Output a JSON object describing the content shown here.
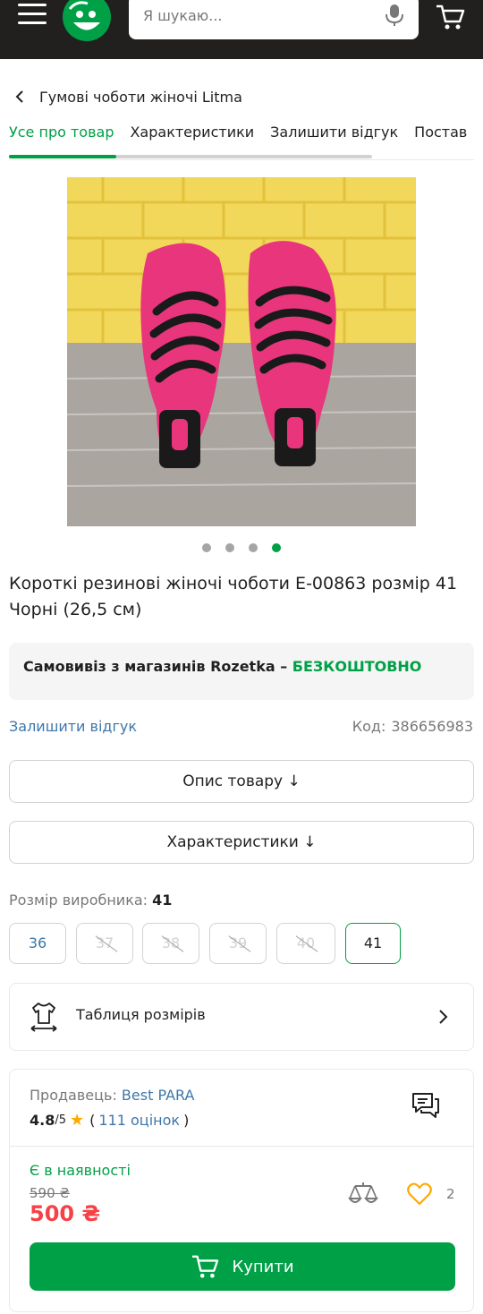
{
  "header": {
    "search_placeholder": "Я шукаю...",
    "colors": {
      "bg": "#221f1f",
      "logo": "#00a046"
    },
    "icons": [
      "menu-icon",
      "rozetka-logo",
      "microphone-icon",
      "cart-icon"
    ]
  },
  "breadcrumb": {
    "title": "Гумові чоботи жіночі Litma"
  },
  "tabs": [
    {
      "label": "Усе про товар",
      "active": true
    },
    {
      "label": "Характеристики",
      "active": false
    },
    {
      "label": "Залишити відгук",
      "active": false
    },
    {
      "label": "Постав",
      "active": false
    }
  ],
  "gallery": {
    "image_count": 4,
    "active_index": 4
  },
  "product": {
    "title": "Короткі резинові жіночі чоботи E-00863 розмір 41 Чорні (26,5 см)",
    "pickup_prefix": "Самовивіз з магазинів Rozetka – ",
    "pickup_free": "БЕЗКОШТОВНО",
    "review_link": "Залишити відгук",
    "code_label": "Код:",
    "code_value": "386656983"
  },
  "actions": {
    "description": "Опис товару ↓",
    "characteristics": "Характеристики ↓"
  },
  "sizes": {
    "label": "Розмір виробника:",
    "selected": "41",
    "options": [
      {
        "label": "36",
        "available": true
      },
      {
        "label": "37",
        "available": false
      },
      {
        "label": "38",
        "available": false
      },
      {
        "label": "39",
        "available": false
      },
      {
        "label": "40",
        "available": false
      },
      {
        "label": "41",
        "available": true,
        "selected": true
      }
    ],
    "table_label": "Таблиця розмірів"
  },
  "seller": {
    "label": "Продавець:",
    "name": "Best PARA",
    "rating": "4.8",
    "rating_of": "/5",
    "reviews_open": "(",
    "reviews_count": "111 оцінок",
    "reviews_close": ")"
  },
  "offer": {
    "stock": "Є в наявності",
    "old_price": "590 ₴",
    "price": "500 ₴",
    "wishlist_count": "2",
    "buy_label": "Купити",
    "colors": {
      "accent": "#00a046",
      "price": "#f84147",
      "link": "#3e77aa",
      "star": "#ffa900"
    }
  }
}
